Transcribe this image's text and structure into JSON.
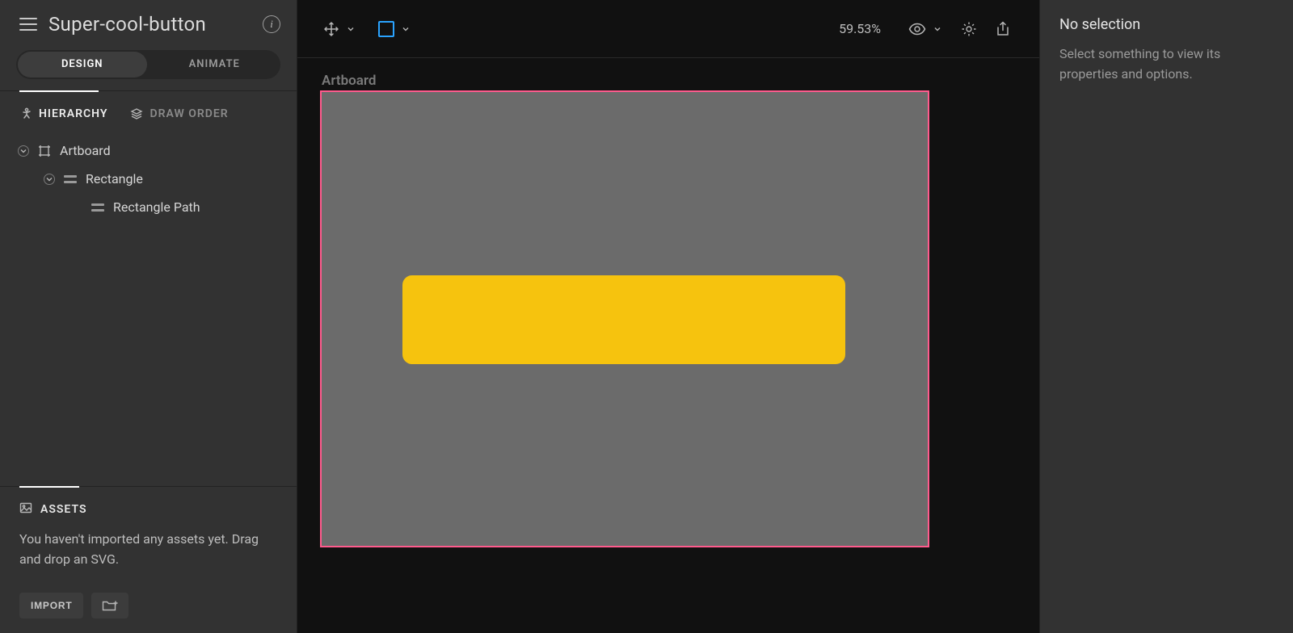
{
  "header": {
    "file_title": "Super-cool-button"
  },
  "mode_tabs": {
    "design": "DESIGN",
    "animate": "ANIMATE"
  },
  "panel_tabs": {
    "hierarchy": "HIERARCHY",
    "draw_order": "DRAW ORDER"
  },
  "tree": {
    "artboard": "Artboard",
    "rectangle": "Rectangle",
    "rectangle_path": "Rectangle Path"
  },
  "assets": {
    "title": "ASSETS",
    "empty_message": "You haven't imported any assets yet. Drag and drop an SVG.",
    "import_label": "IMPORT"
  },
  "toolbar": {
    "zoom": "59.53%"
  },
  "canvas": {
    "artboard_label": "Artboard",
    "artboard_bg": "#6b6b6b",
    "selection_outline": "#ff5b8d",
    "rect_fill": "#f6c30e"
  },
  "inspector": {
    "title": "No selection",
    "message": "Select something to view its properties and options."
  }
}
